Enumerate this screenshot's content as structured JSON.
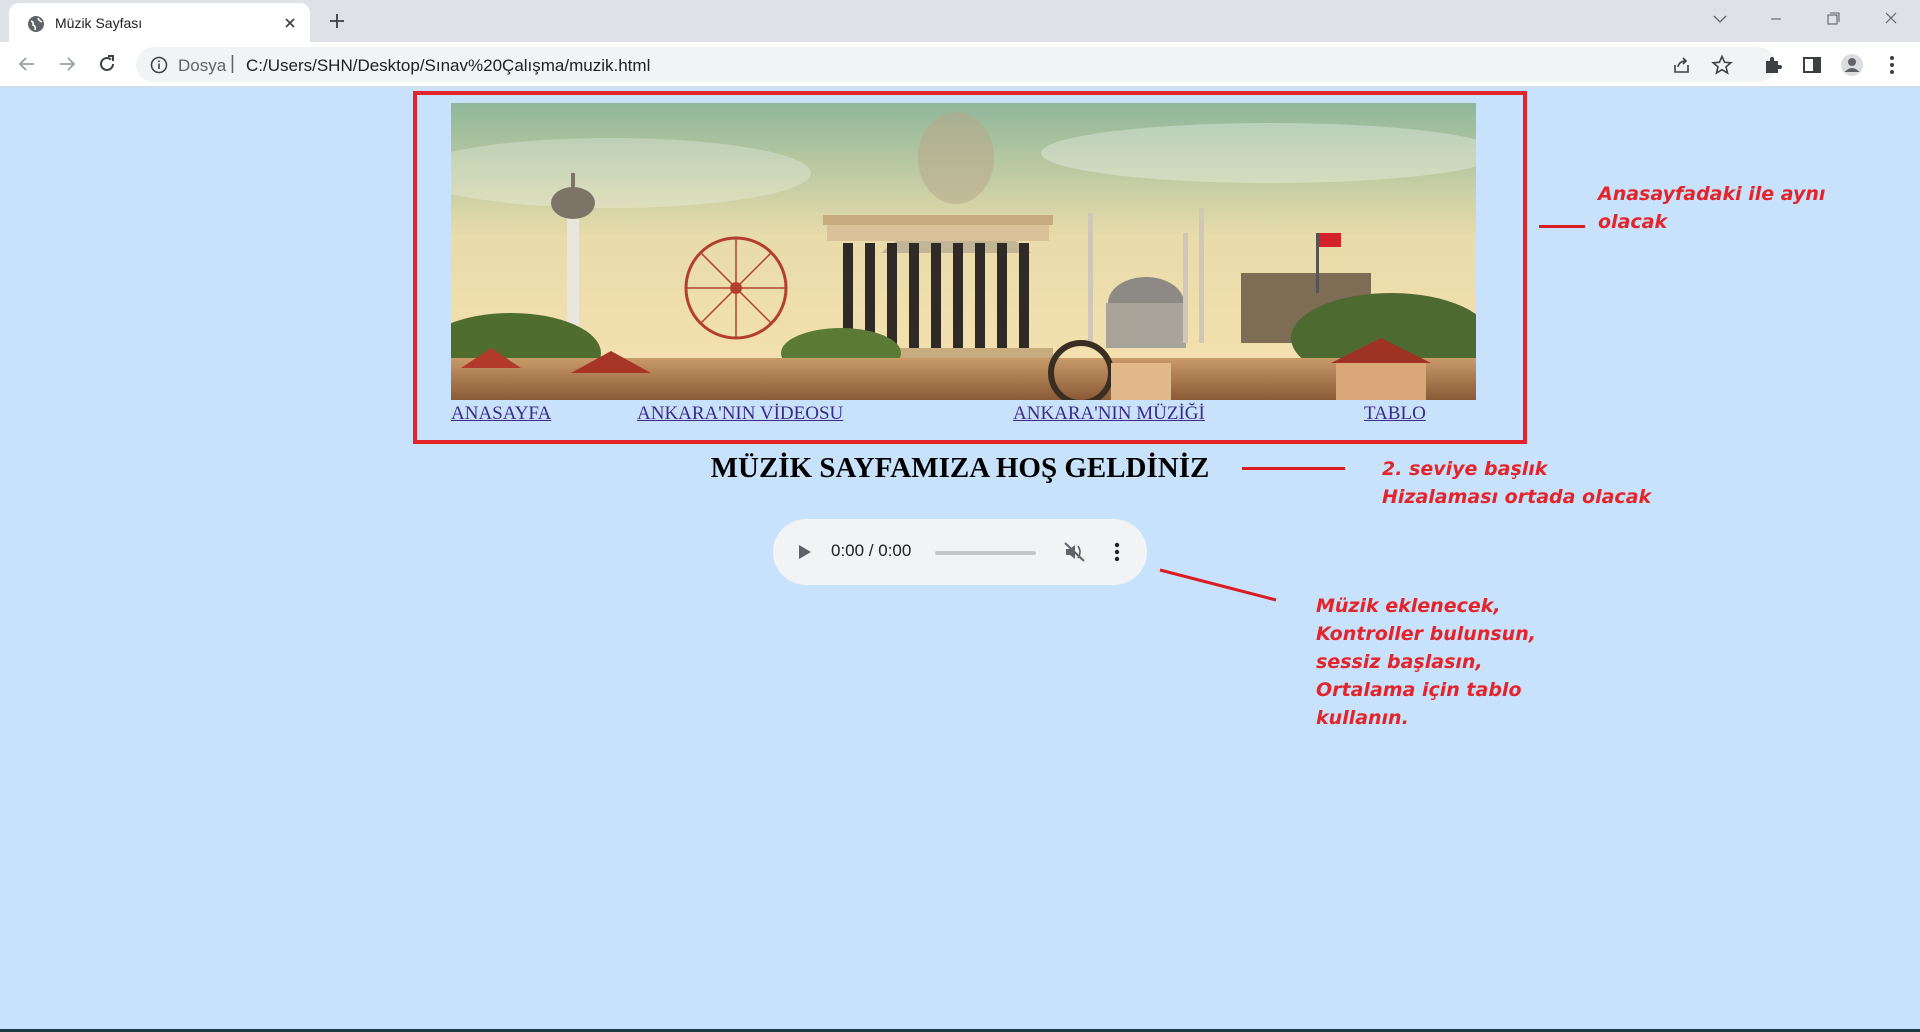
{
  "browser": {
    "tab_title": "Müzik Sayfası",
    "scheme_label": "Dosya",
    "url_separator": "|",
    "url": "C:/Users/SHN/Desktop/Sınav%20Çalışma/muzik.html"
  },
  "page": {
    "nav": [
      "ANASAYFA",
      "ANKARA'NIN VİDEOSU",
      "ANKARA'NIN MÜZİĞİ",
      "TABLO"
    ],
    "heading": "MÜZİK SAYFAMIZA HOŞ GELDİNİZ",
    "audio": {
      "time": "0:00 / 0:00",
      "muted": true,
      "progress": 0
    }
  },
  "annotations": {
    "header_note": [
      "Anasayfadaki ile aynı",
      "olacak"
    ],
    "heading_note": [
      "2. seviye başlık",
      "Hizalaması ortada olacak"
    ],
    "audio_note": [
      "Müzik eklenecek,",
      "Kontroller bulunsun,",
      "sessiz başlasın,",
      "Ortalama için tablo",
      "kullanın."
    ]
  },
  "colors": {
    "page_background": "#c9e2fb",
    "annotation_red": "#e3242b",
    "link": "#3b2a8a"
  },
  "icons": [
    "globe-icon",
    "close-icon",
    "plus-icon",
    "chevron-down-icon",
    "minimize-icon",
    "restore-icon",
    "back-arrow-icon",
    "forward-arrow-icon",
    "reload-icon",
    "info-icon",
    "share-icon",
    "star-icon",
    "puzzle-icon",
    "side-panel-icon",
    "profile-icon",
    "kebab-menu-icon",
    "play-icon",
    "muted-speaker-icon"
  ]
}
